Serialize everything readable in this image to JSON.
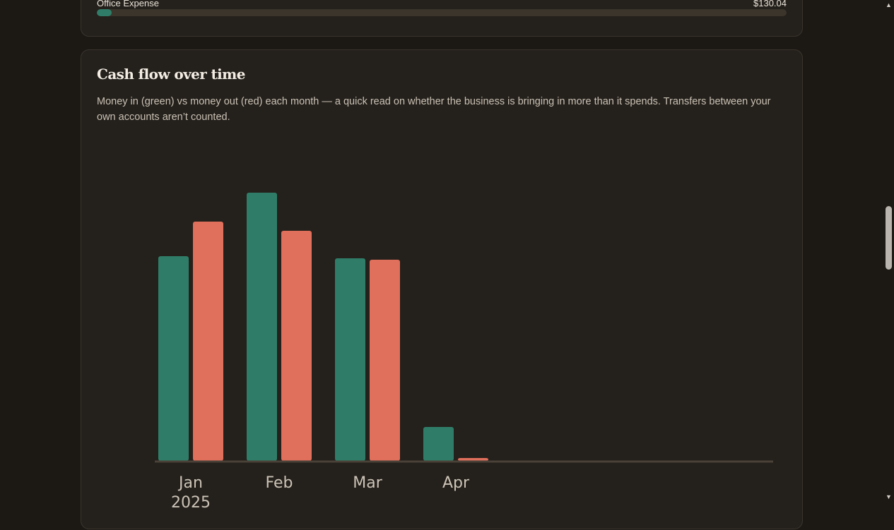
{
  "top_card": {
    "category_label": "Office Expense",
    "category_amount": "$130.04",
    "progress_fraction": 0.022,
    "progress_color": "#2f7d68"
  },
  "cashflow": {
    "title": "Cash flow over time",
    "description": "Money in (green) vs money out (red) each month — a quick read on whether the business is bringing in more than it spends. Transfers between your own accounts aren’t counted."
  },
  "colors": {
    "money_in": "#2f7d68",
    "money_out": "#e06f5b",
    "axis": "#4a4238"
  },
  "chart_data": {
    "type": "bar",
    "categories": [
      "Jan\n2025",
      "Feb",
      "Mar",
      "Apr"
    ],
    "series": [
      {
        "values": [
          290,
          380,
          287,
          48
        ]
      },
      {
        "values": [
          339,
          326,
          285,
          4
        ]
      }
    ],
    "total_slots": 7,
    "ylim": [
      0,
      420
    ],
    "legend": "none",
    "grid": false
  }
}
